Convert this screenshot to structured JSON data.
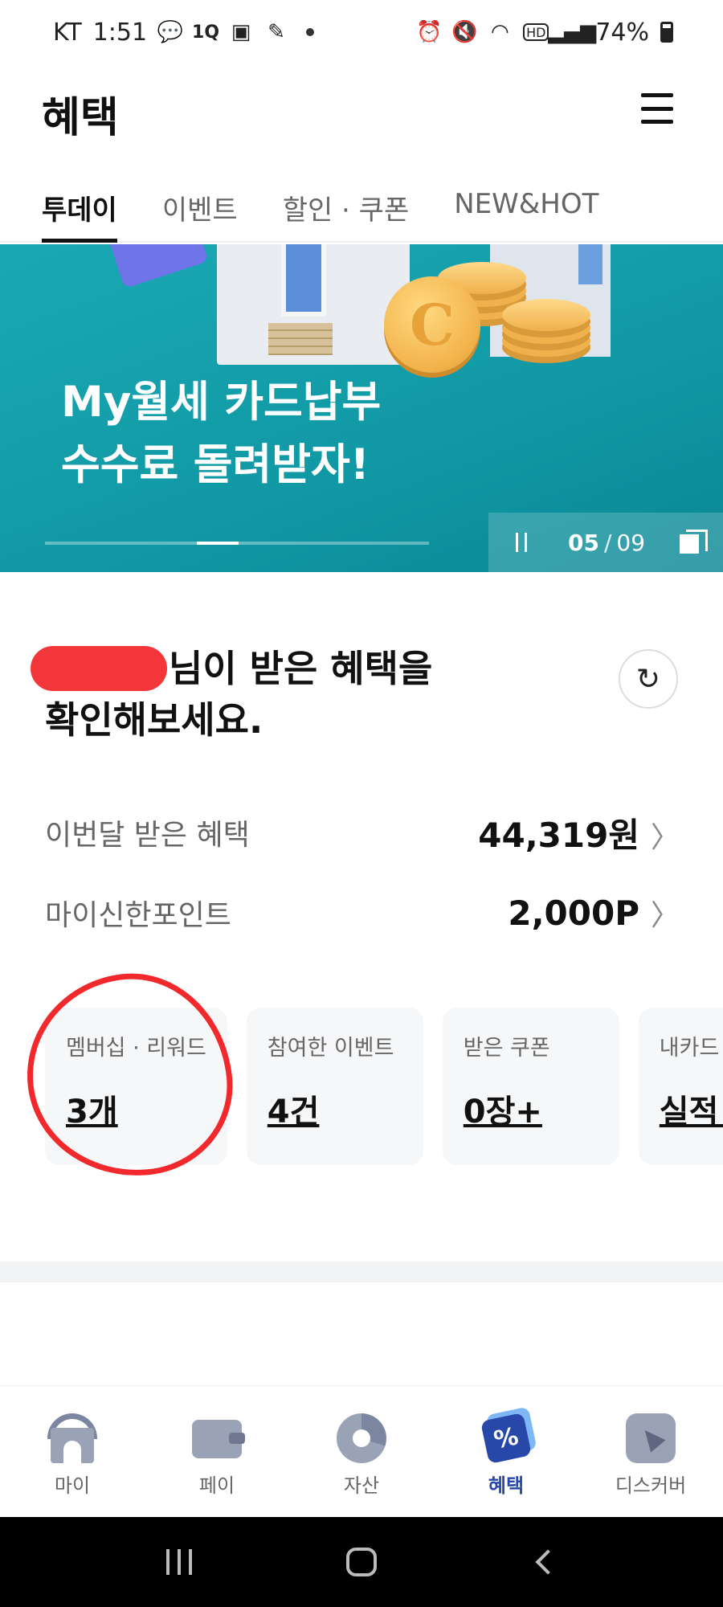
{
  "status_bar": {
    "carrier": "KT",
    "time": "1:51",
    "icons_left": [
      "chat-icon",
      "1q-icon",
      "gallery-icon",
      "notification-icon"
    ],
    "icons_right": [
      "alarm-icon",
      "mute-icon",
      "wifi-icon",
      "hd-icon",
      "signal-icon",
      "battery-icon"
    ],
    "battery": "74%"
  },
  "header": {
    "title": "혜택"
  },
  "tabs": [
    {
      "label": "투데이",
      "active": true
    },
    {
      "label": "이벤트",
      "active": false
    },
    {
      "label": "할인 · 쿠폰",
      "active": false
    },
    {
      "label": "NEW&HOT",
      "active": false
    }
  ],
  "banner": {
    "line1": "My월세 카드납부",
    "line2": "수수료 돌려받자!",
    "current": "05",
    "separator": "/",
    "total": "09",
    "progress_fraction": 0.444
  },
  "benefits": {
    "greeting_line1": "님이 받은 혜택을",
    "greeting_line2": "확인해보세요.",
    "stats": [
      {
        "label": "이번달 받은 혜택",
        "value": "44,319원"
      },
      {
        "label": "마이신한포인트",
        "value": "2,000P"
      }
    ],
    "cards": [
      {
        "label": "멤버십 · 리워드",
        "value": "3개"
      },
      {
        "label": "참여한 이벤트",
        "value": "4건"
      },
      {
        "label": "받은 쿠폰",
        "value": "0장+"
      },
      {
        "label": "내카드",
        "value": "실적 · "
      }
    ]
  },
  "bottom_nav": [
    {
      "label": "마이",
      "icon": "home-icon",
      "active": false
    },
    {
      "label": "페이",
      "icon": "wallet-icon",
      "active": false
    },
    {
      "label": "자산",
      "icon": "pie-chart-icon",
      "active": false
    },
    {
      "label": "혜택",
      "icon": "benefit-tag-icon",
      "active": true
    },
    {
      "label": "디스커버",
      "icon": "compass-icon",
      "active": false
    }
  ],
  "accent_color": "#2748a8",
  "banner_color": "#119aa6"
}
